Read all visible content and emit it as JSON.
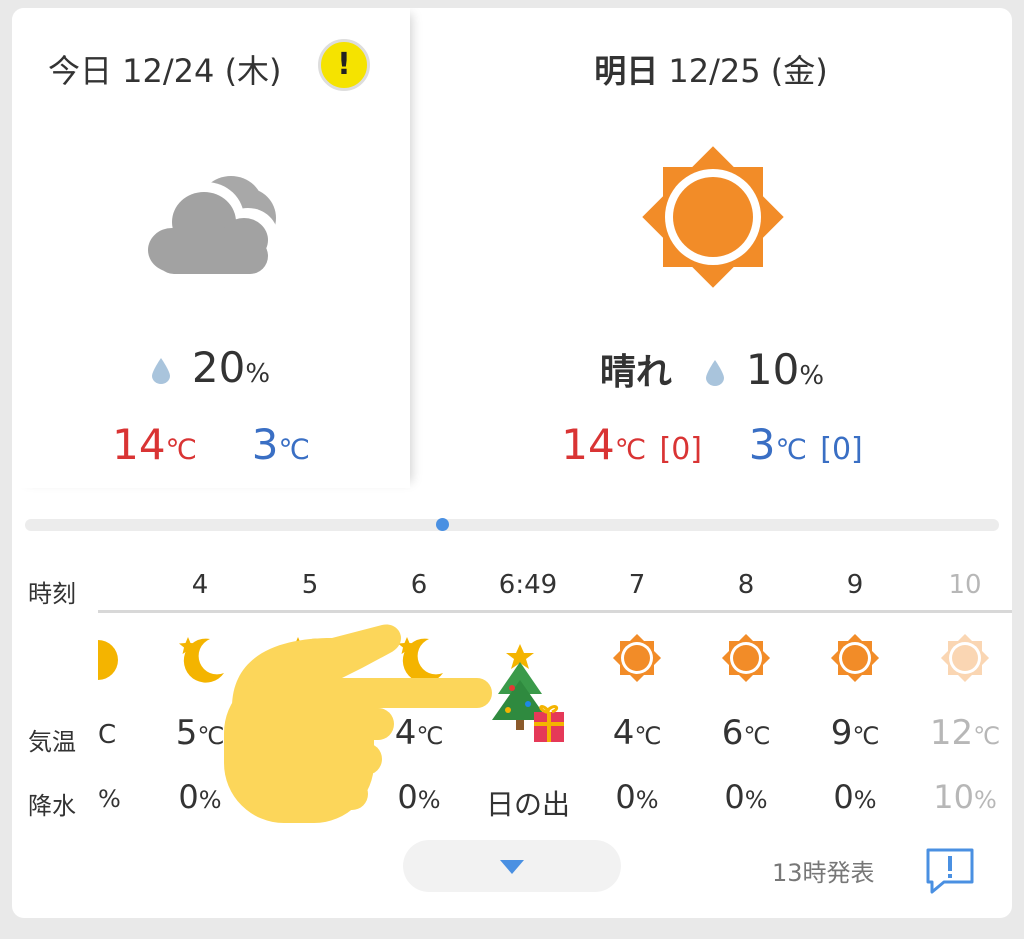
{
  "today": {
    "title": "今日 12/24 (木)",
    "alert_icon": "exclamation",
    "weather_icon": "cloudy-icon",
    "precip_value": "20",
    "precip_unit": "%",
    "high": "14",
    "low": "3",
    "temp_unit": "℃"
  },
  "tomorrow": {
    "title_bold": "明日",
    "title_rest": " 12/25 (金)",
    "weather_icon": "sunny-icon",
    "condition": "晴れ",
    "precip_value": "10",
    "precip_unit": "%",
    "high": "14",
    "low": "3",
    "temp_unit": "℃",
    "high_diff": "[0]",
    "low_diff": "[0]"
  },
  "hourly": {
    "time_label": "時刻",
    "temp_label": "気温",
    "precip_label": "降水",
    "partial_temp": "C",
    "partial_precip": "%",
    "columns": [
      {
        "time": "4",
        "icon": "moon-icon",
        "temp": "5",
        "unit": "℃",
        "precip": "0",
        "precip_unit": "%"
      },
      {
        "time": "5",
        "icon": "moon-icon",
        "temp": "",
        "unit": "",
        "precip": "",
        "precip_unit": ""
      },
      {
        "time": "6",
        "icon": "moon-icon",
        "temp": "4",
        "unit": "℃",
        "precip": "0",
        "precip_unit": "%"
      },
      {
        "time": "6:49",
        "icon": "christmas-tree-icon",
        "temp": "",
        "unit": "",
        "precip": "日の出",
        "precip_unit": ""
      },
      {
        "time": "7",
        "icon": "sun-icon",
        "temp": "4",
        "unit": "℃",
        "precip": "0",
        "precip_unit": "%"
      },
      {
        "time": "8",
        "icon": "sun-icon",
        "temp": "6",
        "unit": "℃",
        "precip": "0",
        "precip_unit": "%"
      },
      {
        "time": "9",
        "icon": "sun-icon",
        "temp": "9",
        "unit": "℃",
        "precip": "0",
        "precip_unit": "%"
      },
      {
        "time": "10",
        "icon": "sun-icon",
        "temp": "12",
        "unit": "℃",
        "precip": "10",
        "precip_unit": "%"
      }
    ]
  },
  "footer": {
    "issued": "13時発表",
    "expand_icon": "chevron-down-icon",
    "feedback_icon": "feedback-icon"
  },
  "colors": {
    "hot": "#d93434",
    "cold": "#3a6fc4",
    "sun": "#f28c28",
    "accent": "#4a90e2"
  }
}
